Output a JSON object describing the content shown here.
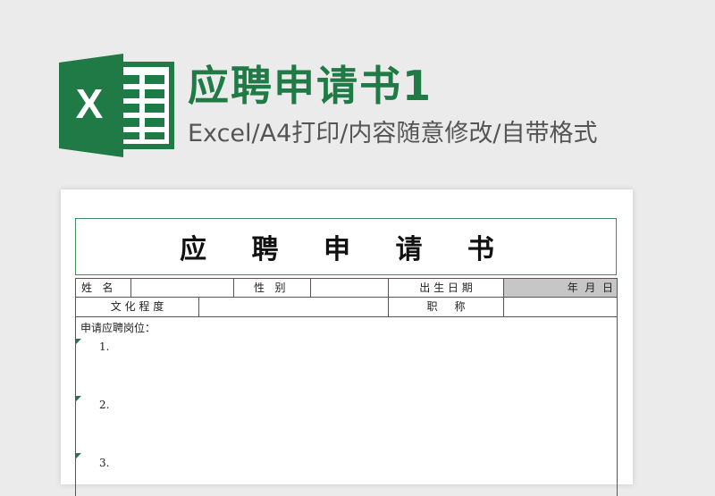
{
  "header": {
    "title": "应聘申请书1",
    "subtitle": "Excel/A4打印/内容随意修改/自带格式",
    "logo_letter": "X",
    "brand_color": "#1f7a45"
  },
  "sheet": {
    "title": "应 聘 申 请 书",
    "row1": [
      "姓   名",
      "",
      "性   别",
      "",
      "出 生 日 期",
      "年  月  日"
    ],
    "row2": [
      "文 化 程 度",
      "",
      "职     称",
      ""
    ],
    "body_label": "申请应聘岗位：",
    "items": [
      "1.",
      "2.",
      "3."
    ]
  }
}
